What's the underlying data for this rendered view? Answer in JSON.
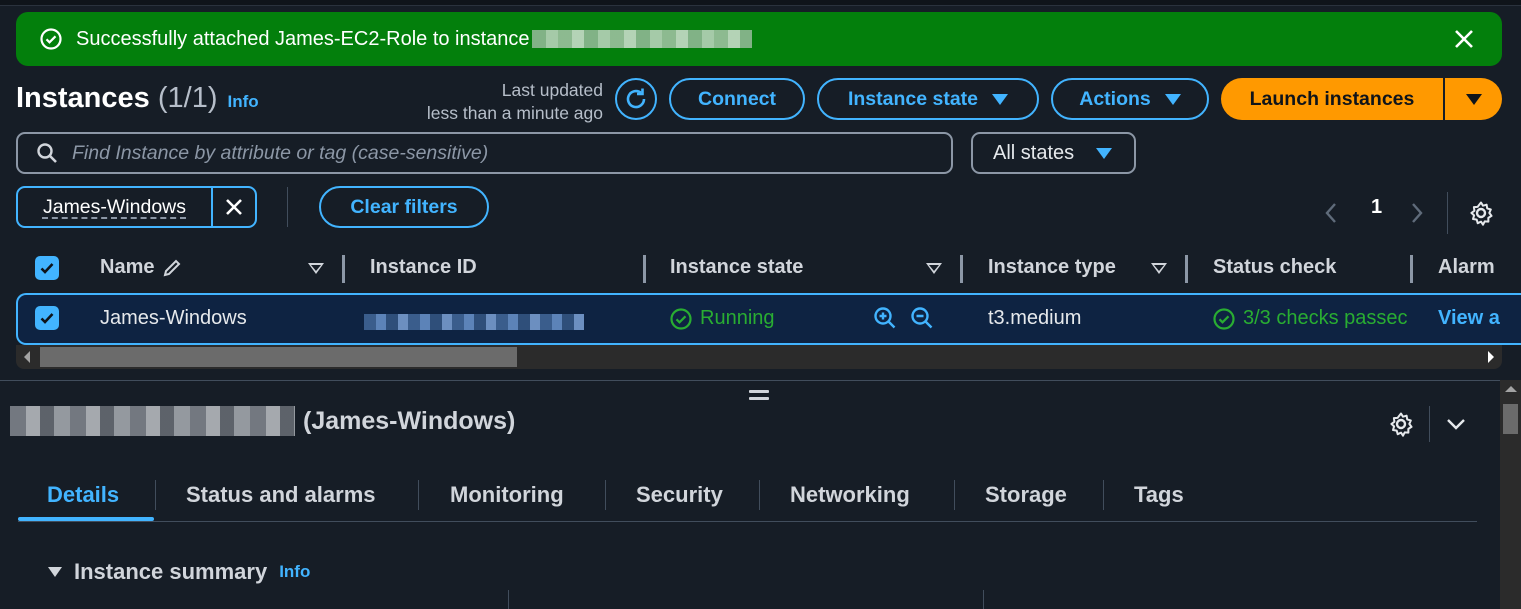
{
  "flash": {
    "message": "Successfully attached James-EC2-Role to instance",
    "color": "#037f0c"
  },
  "header": {
    "title": "Instances",
    "count": "(1/1)",
    "info": "Info",
    "last_updated_line1": "Last updated",
    "last_updated_line2": "less than a minute ago",
    "connect": "Connect",
    "instance_state": "Instance state",
    "actions": "Actions",
    "launch": "Launch instances",
    "accent": "#42b4ff",
    "launch_color": "#ff9900"
  },
  "search": {
    "placeholder": "Find Instance by attribute or tag (case-sensitive)",
    "states_filter": "All states"
  },
  "filters": {
    "token": "James-Windows",
    "clear": "Clear filters"
  },
  "pagination": {
    "prev": "‹",
    "page": "1",
    "next": "›"
  },
  "table": {
    "columns": [
      "Name",
      "Instance ID",
      "Instance state",
      "Instance type",
      "Status check",
      "Alarm"
    ],
    "rows": [
      {
        "name": "James-Windows",
        "state": "Running",
        "type": "t3.medium",
        "status": "3/3 checks passec",
        "alarm": "View a"
      }
    ]
  },
  "details": {
    "title_suffix": "(James-Windows)",
    "tabs": [
      "Details",
      "Status and alarms",
      "Monitoring",
      "Security",
      "Networking",
      "Storage",
      "Tags"
    ],
    "active_tab": "Details",
    "section": "Instance summary",
    "section_info": "Info"
  }
}
